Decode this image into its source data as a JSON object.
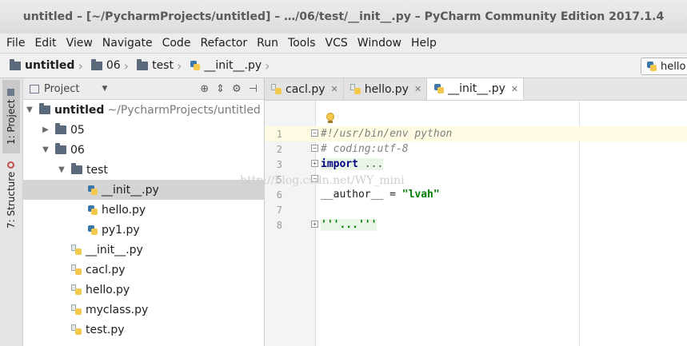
{
  "window": {
    "title": "untitled – [~/PycharmProjects/untitled] – …/06/test/__init__.py – PyCharm Community Edition 2017.1.4"
  },
  "menu": [
    "File",
    "Edit",
    "View",
    "Navigate",
    "Code",
    "Refactor",
    "Run",
    "Tools",
    "VCS",
    "Window",
    "Help"
  ],
  "breadcrumbs": [
    "untitled",
    "06",
    "test",
    "__init__.py"
  ],
  "run_config": {
    "label": "hello"
  },
  "tool_windows": {
    "project": "1: Project",
    "structure": "7: Structure"
  },
  "project_panel": {
    "view_label": "Project",
    "tree": [
      {
        "label": "untitled",
        "path": "~/PycharmProjects/untitled"
      },
      {
        "label": "05"
      },
      {
        "label": "06"
      },
      {
        "label": "test"
      },
      {
        "label": "__init__.py"
      },
      {
        "label": "hello.py"
      },
      {
        "label": "py1.py"
      },
      {
        "label": "__init__.py"
      },
      {
        "label": "cacl.py"
      },
      {
        "label": "hello.py"
      },
      {
        "label": "myclass.py"
      },
      {
        "label": "test.py"
      }
    ]
  },
  "editor": {
    "tabs": [
      {
        "label": "cacl.py"
      },
      {
        "label": "hello.py"
      },
      {
        "label": "__init__.py"
      }
    ],
    "lines": [
      {
        "num": "1",
        "text": "#!/usr/bin/env python"
      },
      {
        "num": "2",
        "text": "# coding:utf-8"
      },
      {
        "num": "3",
        "kw": "import",
        "rest": " ..."
      },
      {
        "num": "5"
      },
      {
        "num": "6",
        "pre": "__author__ = ",
        "str": "\"lvah\""
      },
      {
        "num": "7"
      },
      {
        "num": "8",
        "text": "'''...'''"
      }
    ]
  },
  "watermark": "http://blog.csdn.net/WY_mini",
  "colors": {
    "keyword": "#000080",
    "string": "#008000",
    "comment": "#808080",
    "selection": "#d4d4d4"
  }
}
